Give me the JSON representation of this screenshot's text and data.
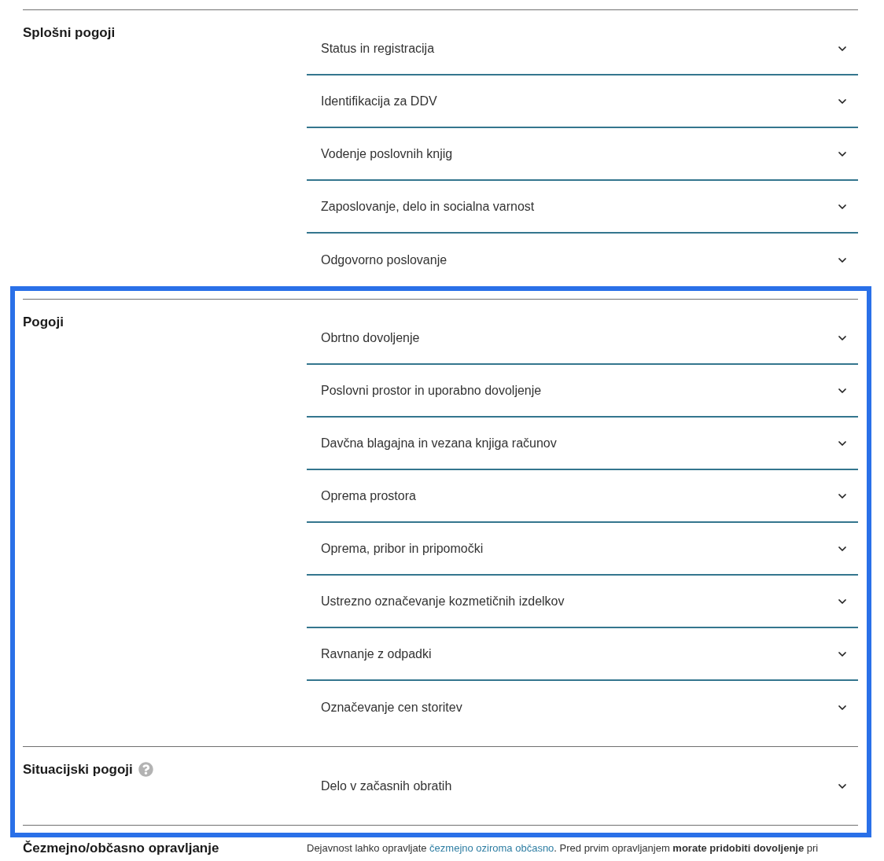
{
  "sections": [
    {
      "kind": "accordion",
      "title": "Splošni pogoji",
      "help": false,
      "highlighted": false,
      "items": [
        {
          "label": "Status in registracija",
          "expanded": false
        },
        {
          "label": "Identifikacija za DDV",
          "expanded": false
        },
        {
          "label": "Vodenje poslovnih knjig",
          "expanded": false
        },
        {
          "label": "Zaposlovanje, delo in socialna varnost",
          "expanded": false
        },
        {
          "label": "Odgovorno poslovanje",
          "expanded": false
        }
      ]
    },
    {
      "kind": "accordion",
      "title": "Pogoji",
      "help": false,
      "highlighted": true,
      "items": [
        {
          "label": "Obrtno dovoljenje",
          "expanded": false
        },
        {
          "label": "Poslovni prostor in uporabno dovoljenje",
          "expanded": false
        },
        {
          "label": "Davčna blagajna in vezana knjiga računov",
          "expanded": false
        },
        {
          "label": "Oprema prostora",
          "expanded": false
        },
        {
          "label": "Oprema, pribor in pripomočki",
          "expanded": false
        },
        {
          "label": "Ustrezno označevanje kozmetičnih izdelkov",
          "expanded": false
        },
        {
          "label": "Ravnanje z odpadki",
          "expanded": false
        },
        {
          "label": "Označevanje cen storitev",
          "expanded": false
        }
      ]
    },
    {
      "kind": "accordion",
      "title": "Situacijski pogoji",
      "help": true,
      "highlighted": true,
      "items": [
        {
          "label": "Delo v začasnih obratih",
          "expanded": false
        }
      ]
    },
    {
      "kind": "text",
      "title": "Čezmejno/občasno opravljanje",
      "help": false,
      "highlighted": false,
      "paragraph": {
        "before": "Dejavnost lahko opravljate ",
        "link": "čezmejno oziroma občasno",
        "after": ". Pred prvim opravljanjem **morate pridobiti dovoljenje** pri"
      }
    }
  ]
}
